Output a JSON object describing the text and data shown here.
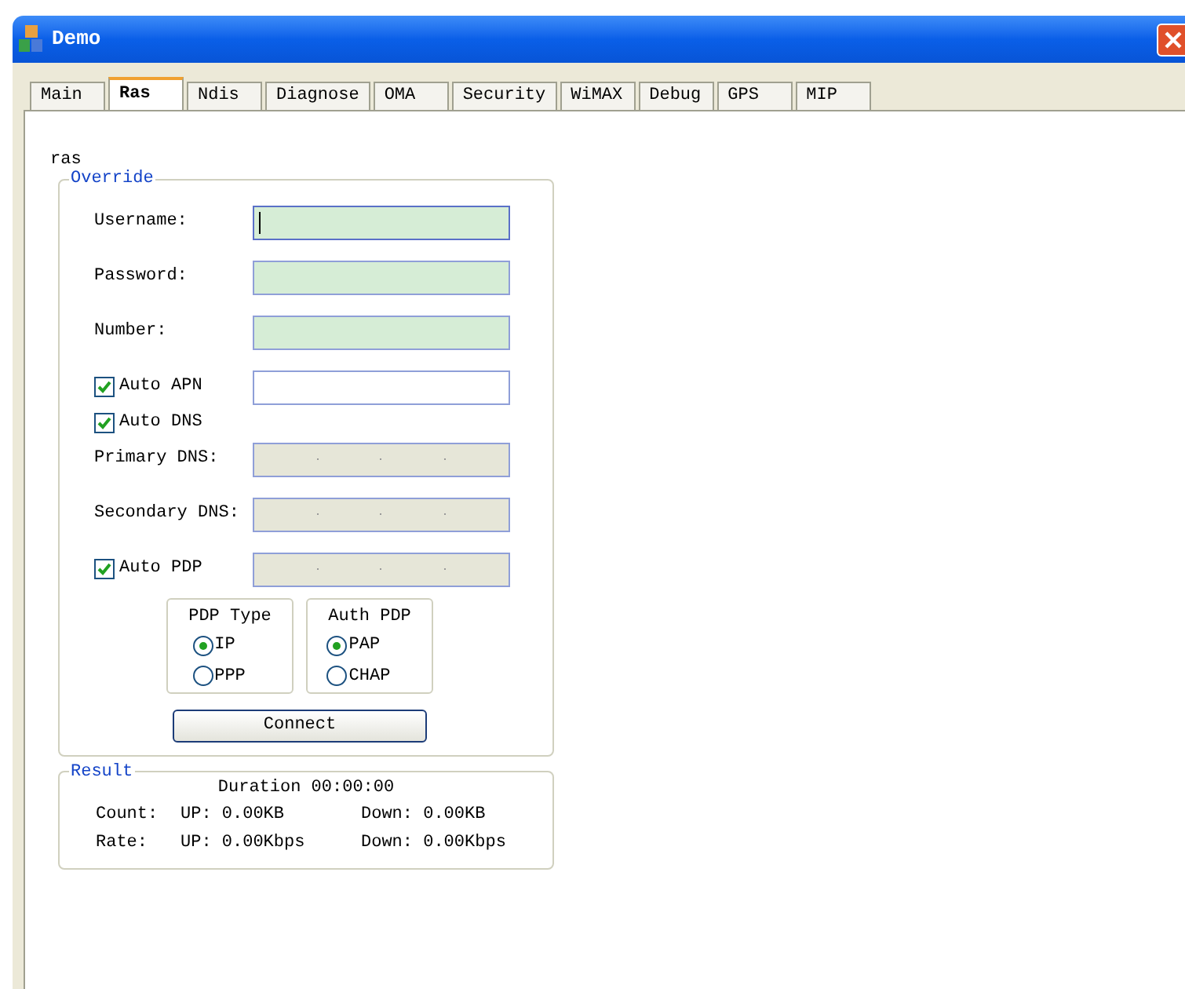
{
  "window": {
    "title": "Demo"
  },
  "tabs": [
    {
      "label": "Main",
      "selected": false
    },
    {
      "label": "Ras",
      "selected": true
    },
    {
      "label": "Ndis",
      "selected": false
    },
    {
      "label": "Diagnose",
      "selected": false
    },
    {
      "label": "OMA",
      "selected": false
    },
    {
      "label": "Security",
      "selected": false
    },
    {
      "label": "WiMAX",
      "selected": false
    },
    {
      "label": "Debug",
      "selected": false
    },
    {
      "label": "GPS",
      "selected": false
    },
    {
      "label": "MIP",
      "selected": false
    }
  ],
  "page": {
    "heading": "ras",
    "override": {
      "title": "Override",
      "rows": [
        {
          "kind": "field",
          "label": "Username:",
          "focused": true
        },
        {
          "kind": "field",
          "label": "Password:",
          "focused": false
        },
        {
          "kind": "field",
          "label": "Number:",
          "focused": false
        },
        {
          "kind": "check_field",
          "label": "Auto APN",
          "checked": true
        },
        {
          "kind": "check",
          "label": "Auto DNS",
          "checked": true
        },
        {
          "kind": "ip",
          "label": "Primary DNS:"
        },
        {
          "kind": "ip",
          "label": "Secondary DNS:"
        },
        {
          "kind": "check_ip",
          "label": "Auto PDP",
          "checked": true
        }
      ],
      "radio_groups": [
        {
          "title": "PDP Type",
          "options": [
            {
              "label": "IP",
              "selected": true
            },
            {
              "label": "PPP",
              "selected": false
            }
          ]
        },
        {
          "title": "Auth PDP",
          "options": [
            {
              "label": "PAP",
              "selected": true
            },
            {
              "label": "CHAP",
              "selected": false
            }
          ]
        }
      ],
      "connect_button": "Connect"
    },
    "result": {
      "title": "Result",
      "duration": "Duration 00:00:00",
      "rows": [
        {
          "label": "Count:",
          "up": "UP: 0.00KB",
          "down": "Down: 0.00KB"
        },
        {
          "label": "Rate:",
          "up": "UP: 0.00Kbps",
          "down": "Down: 0.00Kbps"
        }
      ]
    }
  }
}
